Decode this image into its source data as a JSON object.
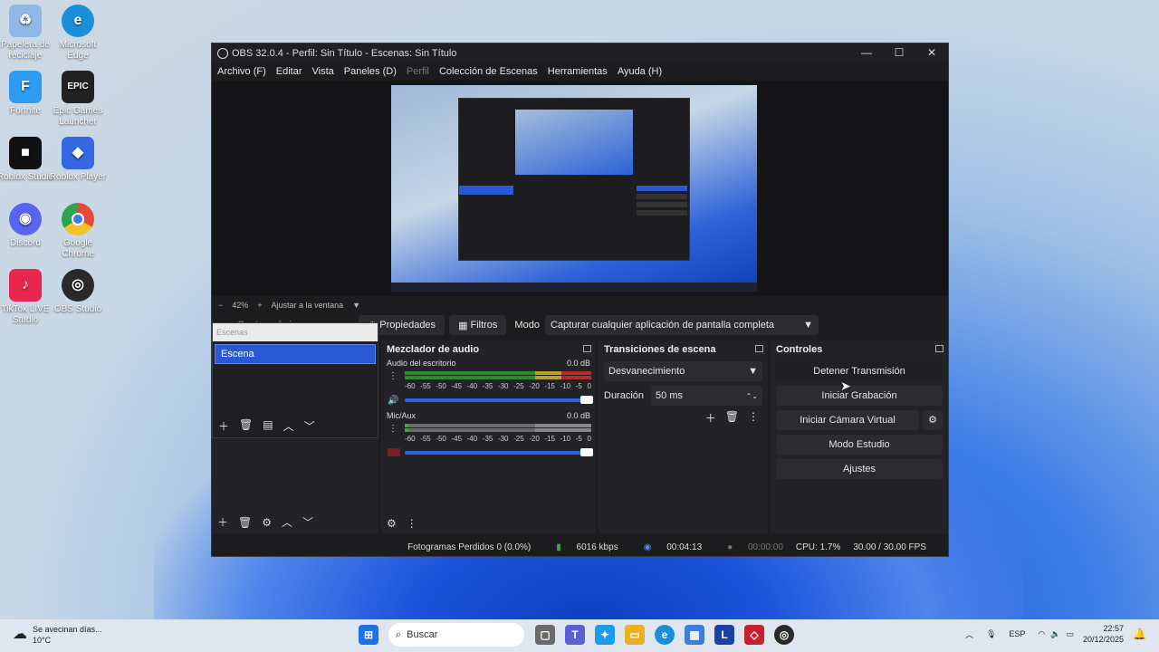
{
  "desktop": {
    "icons": [
      {
        "label": "Papelera de reciclaje",
        "icon": "recycle-bin-icon",
        "color": "#8fb8e8"
      },
      {
        "label": "Microsoft Edge",
        "icon": "edge-icon",
        "color": "#1a8fd8"
      },
      {
        "label": "Fortnite",
        "icon": "fortnite-icon",
        "color": "#2d9bf0"
      },
      {
        "label": "Epic Games Launcher",
        "icon": "epic-games-icon",
        "color": "#222222"
      },
      {
        "label": "Roblox Studio",
        "icon": "roblox-studio-icon",
        "color": "#111111"
      },
      {
        "label": "Roblox Player",
        "icon": "roblox-player-icon",
        "color": "#3467e0"
      },
      {
        "label": "Discord",
        "icon": "discord-icon",
        "color": "#5865f2"
      },
      {
        "label": "Google Chrome",
        "icon": "chrome-icon",
        "color": "#e24a3a"
      },
      {
        "label": "TikTok LIVE Studio",
        "icon": "tiktok-icon",
        "color": "#e8264d"
      },
      {
        "label": "OBS Studio",
        "icon": "obs-icon",
        "color": "#2a2a2a"
      }
    ]
  },
  "obs": {
    "title": "OBS 32.0.4 - Perfil: Sin Título - Escenas: Sin Título",
    "menu": [
      "Archivo (F)",
      "Editar",
      "Vista",
      "Paneles (D)",
      "Perfil",
      "Colección de Escenas",
      "Herramientas",
      "Ayuda (H)"
    ],
    "zoom": {
      "minus": "−",
      "value": "42%",
      "plus": "+",
      "fit": "Ajustar a la ventana"
    },
    "source_bar": {
      "hidden_label": "Captura de juego",
      "properties": "Propiedades",
      "filters": "Filtros",
      "mode_label": "Modo",
      "mode_value": "Capturar cualquier aplicación de pantalla completa"
    },
    "scenes": {
      "header": "Escenas",
      "items": [
        "Escena"
      ]
    },
    "mixer": {
      "title": "Mezclador de audio",
      "channels": [
        {
          "name": "Audio del escritorio",
          "db": "0.0 dB"
        },
        {
          "name": "Mic/Aux",
          "db": "0.0 dB"
        }
      ],
      "scale": [
        "-60",
        "-55",
        "-50",
        "-45",
        "-40",
        "-35",
        "-30",
        "-25",
        "-20",
        "-15",
        "-10",
        "-5",
        "0"
      ]
    },
    "transitions": {
      "title": "Transiciones de escena",
      "selected": "Desvanecimiento",
      "duration_label": "Duración",
      "duration_value": "50 ms"
    },
    "controls": {
      "title": "Controles",
      "buttons": [
        "Detener Transmisión",
        "Iniciar Grabación",
        "Iniciar Cámara Virtual",
        "Modo Estudio",
        "Ajustes"
      ]
    },
    "status": {
      "dropped": "Fotogramas Perdidos 0 (0.0%)",
      "bitrate": "6016 kbps",
      "stream_time": "00:04:13",
      "rec_time": "00:00:00",
      "cpu": "CPU: 1.7%",
      "fps": "30.00 / 30.00 FPS"
    }
  },
  "taskbar": {
    "weather_title": "Se avecinan días...",
    "weather_temp": "10°C",
    "search": "Buscar",
    "lang": "ESP",
    "time": "22:57",
    "date": "20/12/2025"
  }
}
